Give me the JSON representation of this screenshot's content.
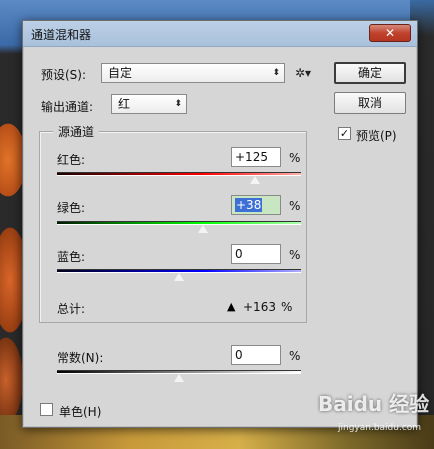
{
  "dialog": {
    "title": "通道混和器",
    "close_glyph": "✕"
  },
  "preset": {
    "label": "预设(S):",
    "value": "自定",
    "gear_glyph": "✲▾"
  },
  "output_channel": {
    "label": "输出通道:",
    "value": "红"
  },
  "buttons": {
    "ok": "确定",
    "cancel": "取消"
  },
  "preview": {
    "label": "预览(P)",
    "checked": true
  },
  "source_channels": {
    "title": "源通道",
    "red": {
      "label": "红色:",
      "value": "+125",
      "unit": "%",
      "slider_fraction": 0.81
    },
    "green": {
      "label": "绿色:",
      "value": "+38",
      "unit": "%",
      "slider_fraction": 0.6
    },
    "blue": {
      "label": "蓝色:",
      "value": "0",
      "unit": "%",
      "slider_fraction": 0.5
    },
    "total": {
      "label": "总计:",
      "value": "+163",
      "unit": "%",
      "warning_icon": "warning-icon"
    }
  },
  "constant": {
    "label": "常数(N):",
    "value": "0",
    "unit": "%",
    "slider_fraction": 0.5
  },
  "monochrome": {
    "label": "单色(H)",
    "checked": false
  },
  "watermark": {
    "brand": "Baidu 经验",
    "url": "jingyan.baidu.com"
  },
  "colors": {
    "dialog_bg": "#d6d6d6",
    "titlebar": "#bcd0e6",
    "close": "#c0432e",
    "active_field": "#c9e6c2",
    "selection": "#3d6fd6"
  }
}
